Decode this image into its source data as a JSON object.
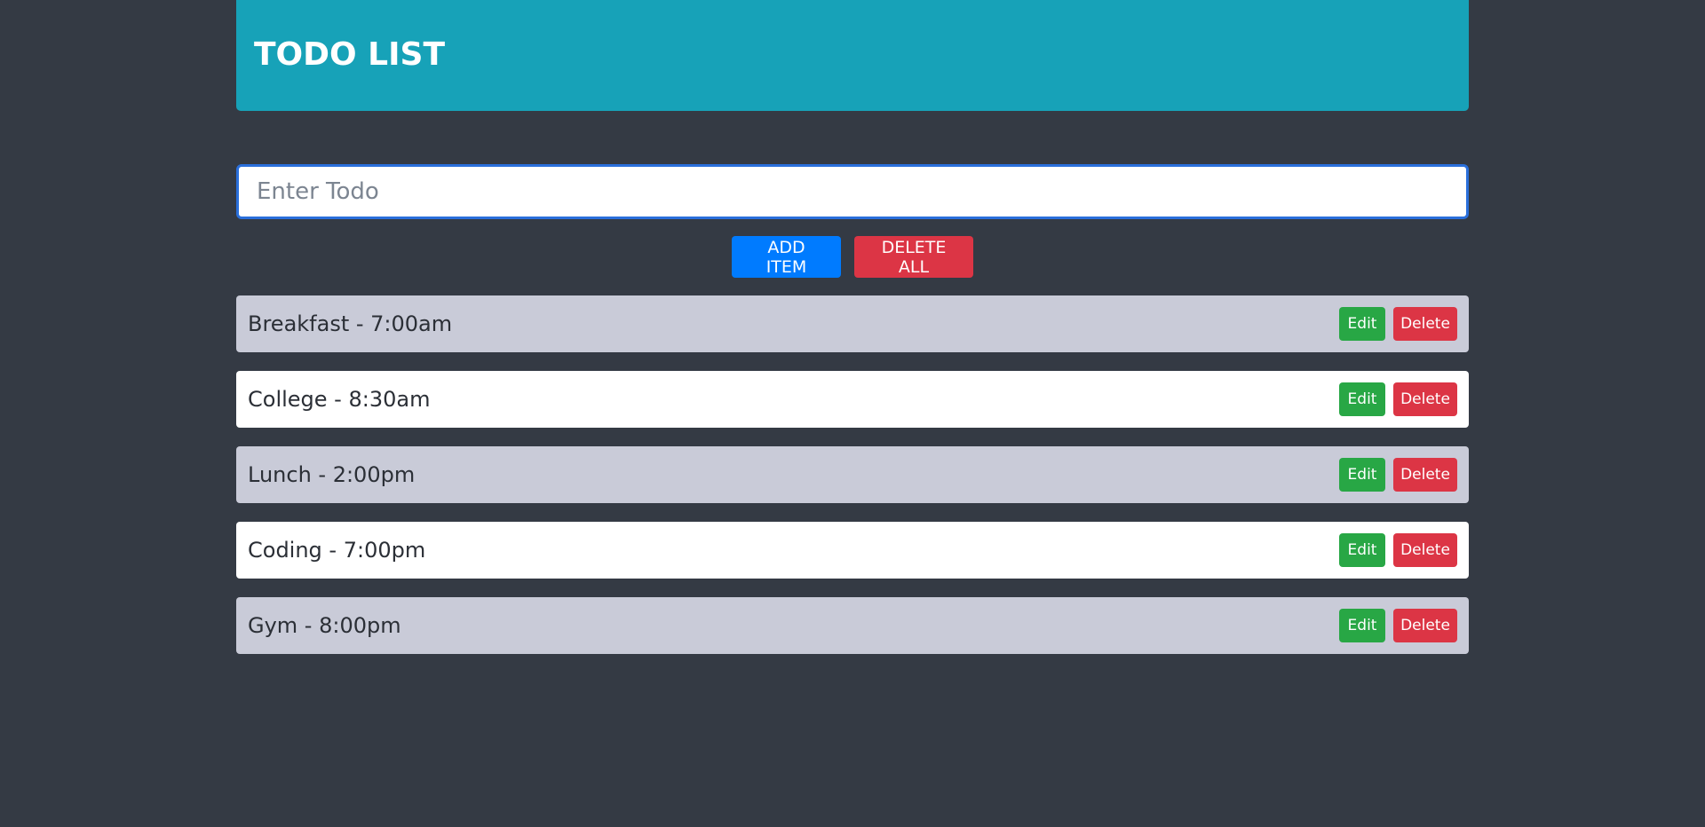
{
  "header": {
    "title": "TODO LIST"
  },
  "input": {
    "placeholder": "Enter Todo",
    "value": ""
  },
  "actions": {
    "add_label": "ADD ITEM",
    "delete_all_label": "DELETE ALL"
  },
  "todos": [
    {
      "text": "Breakfast - 7:00am",
      "edit_label": "Edit",
      "delete_label": "Delete"
    },
    {
      "text": "College - 8:30am",
      "edit_label": "Edit",
      "delete_label": "Delete"
    },
    {
      "text": "Lunch - 2:00pm",
      "edit_label": "Edit",
      "delete_label": "Delete"
    },
    {
      "text": "Coding - 7:00pm",
      "edit_label": "Edit",
      "delete_label": "Delete"
    },
    {
      "text": "Gym - 8:00pm",
      "edit_label": "Edit",
      "delete_label": "Delete"
    }
  ],
  "colors": {
    "background": "#343a44",
    "header": "#17a2b8",
    "primary": "#007bff",
    "danger": "#dc3545",
    "success": "#28a745",
    "row_alt": "#c9cbd8"
  }
}
